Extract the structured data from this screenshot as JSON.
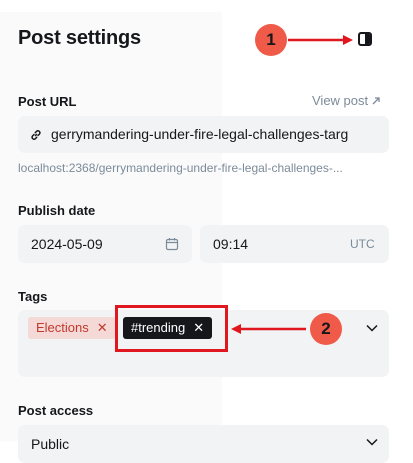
{
  "header": {
    "title": "Post settings",
    "toggle_icon": "sidebar-toggle-icon"
  },
  "post_url": {
    "label": "Post URL",
    "view_link": "View post",
    "value": "gerrymandering-under-fire-legal-challenges-targ",
    "hint": "localhost:2368/gerrymandering-under-fire-legal-challenges-..."
  },
  "publish_date": {
    "label": "Publish date",
    "date": "2024-05-09",
    "time": "09:14",
    "timezone": "UTC"
  },
  "tags": {
    "label": "Tags",
    "items": [
      {
        "label": "Elections"
      },
      {
        "label": "#trending"
      }
    ]
  },
  "post_access": {
    "label": "Post access",
    "value": "Public"
  },
  "annotations": {
    "step1": "1",
    "step2": "2",
    "color": "#e0171f",
    "badge_color": "#f05a48"
  }
}
